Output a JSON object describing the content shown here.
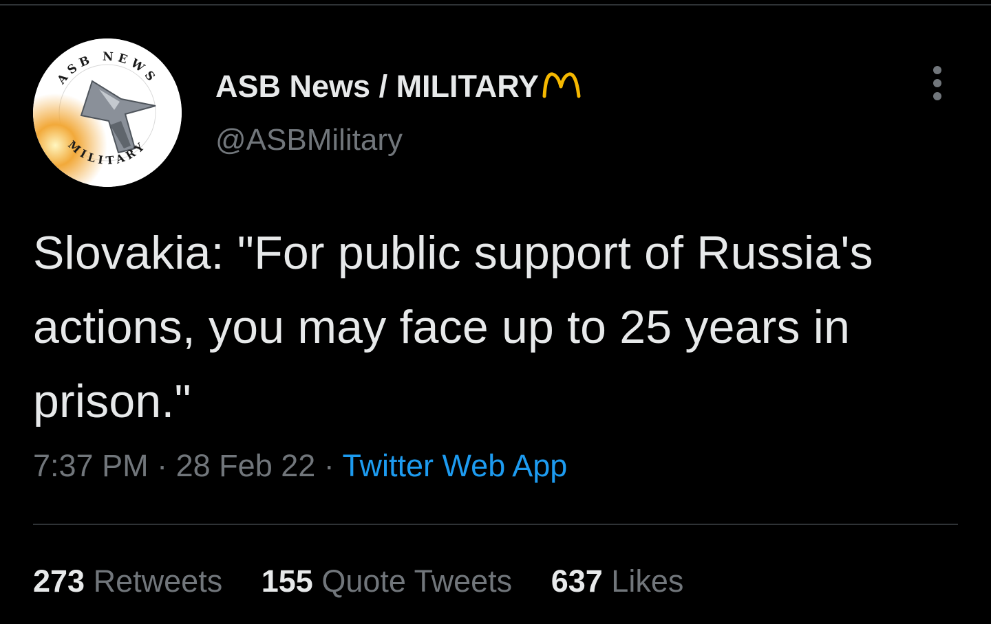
{
  "author": {
    "display_name": "ASB News / MILITARY",
    "handle": "@ASBMilitary",
    "badge_icon": "golden-arches-icon",
    "avatar_text_top": "ASB NEWS",
    "avatar_text_bottom": "MILITARY"
  },
  "tweet": {
    "text": "Slovakia: \"For public support of Russia's actions, you may face up to 25 years in prison.\"",
    "time": "7:37 PM",
    "separator": "·",
    "date": "28 Feb 22",
    "source": "Twitter Web App"
  },
  "stats": {
    "retweets_count": "273",
    "retweets_label": "Retweets",
    "quotes_count": "155",
    "quotes_label": "Quote Tweets",
    "likes_count": "637",
    "likes_label": "Likes"
  },
  "colors": {
    "background": "#000000",
    "text_primary": "#e7e9ea",
    "text_secondary": "#71767b",
    "link": "#1d9bf0",
    "badge": "#f5b800"
  },
  "icons": {
    "more": "more-options-icon"
  }
}
